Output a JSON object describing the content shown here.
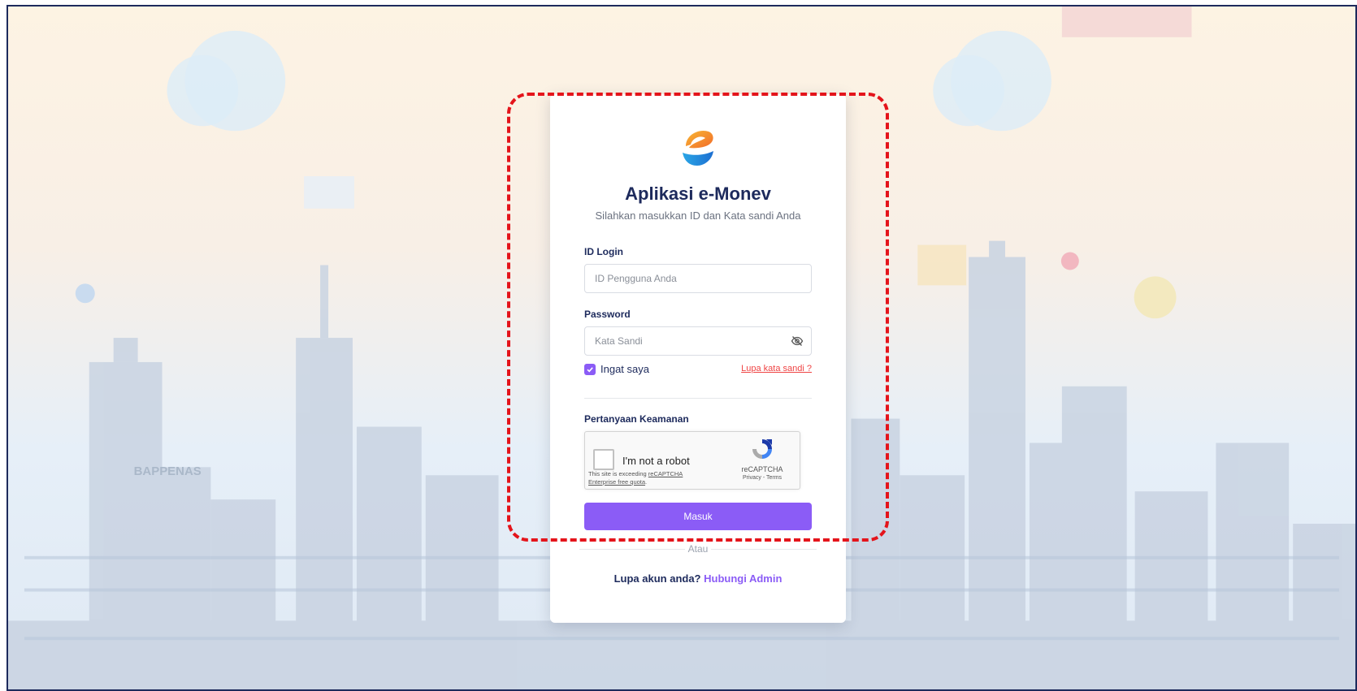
{
  "app": {
    "title": "Aplikasi e-Monev",
    "subtitle": "Silahkan masukkan ID dan Kata sandi Anda"
  },
  "background": {
    "watermark": "BAPPENAS"
  },
  "form": {
    "login_label": "ID Login",
    "login_placeholder": "ID Pengguna Anda",
    "password_label": "Password",
    "password_placeholder": "Kata Sandi",
    "remember_label": "Ingat saya",
    "remember_checked": true,
    "forgot_password": "Lupa kata sandi ?",
    "security_label": "Pertanyaan Keamanan",
    "submit_label": "Masuk",
    "or_label": "Atau",
    "forgot_account": "Lupa akun anda?",
    "contact_admin": "Hubungi Admin"
  },
  "recaptcha": {
    "checkbox_label": "I'm not a robot",
    "note_prefix": "This site is exceeding ",
    "note_link": "reCAPTCHA Enterprise free quota",
    "note_suffix": ".",
    "brand": "reCAPTCHA",
    "privacy": "Privacy",
    "terms": "Terms",
    "separator": " - "
  },
  "colors": {
    "accent": "#8b5cf6",
    "title": "#1d2a5c",
    "danger": "#ef4444",
    "highlight": "#e4141b"
  },
  "icons": {
    "logo": "e-monev-logo",
    "password_toggle": "eye-off-icon",
    "checkbox": "check-icon",
    "recaptcha": "recaptcha-logo"
  }
}
